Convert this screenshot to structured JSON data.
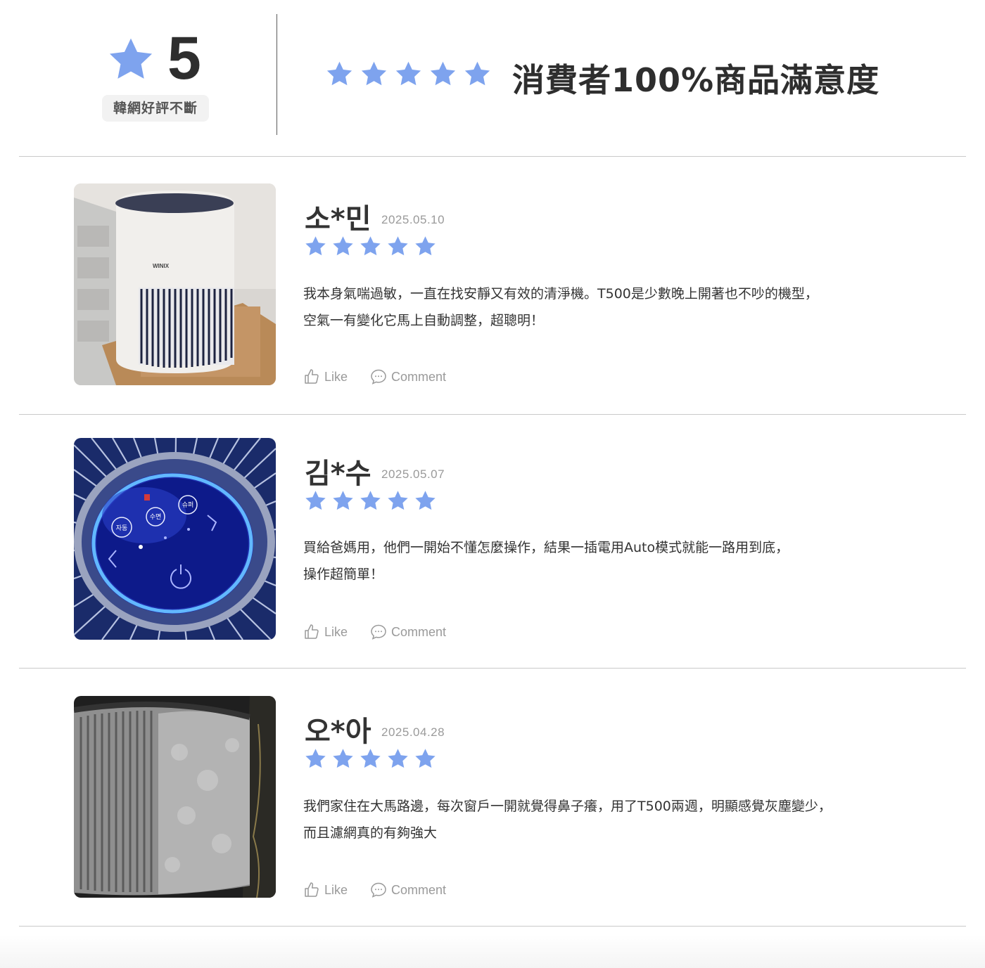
{
  "colors": {
    "star": "#7ea3ee",
    "text": "#2e2e2e",
    "muted": "#9a9a9a",
    "divider": "#c9c9c9"
  },
  "header": {
    "rating_value": "5",
    "rating_badge": "韓網好評不斷",
    "star_count": 5,
    "title": "消費者100%商品滿意度"
  },
  "reviews": [
    {
      "name": "소*민",
      "date": "2025.05.10",
      "stars": 5,
      "text_line1": "我本身氣喘過敏，一直在找安靜又有效的清淨機。T500是少數晚上開著也不吵的機型，",
      "text_line2": "空氣一有變化它馬上自動調整，超聰明！",
      "like_label": "Like",
      "comment_label": "Comment",
      "photo_icon": "air-purifier-photo",
      "photo_brand": "WINIX"
    },
    {
      "name": "김*수",
      "date": "2025.05.07",
      "stars": 5,
      "text_line1": "買給爸媽用，他們一開始不懂怎麼操作，結果一插電用Auto模式就能一路用到底，",
      "text_line2": "操作超簡單！",
      "like_label": "Like",
      "comment_label": "Comment",
      "photo_icon": "control-panel-photo",
      "photo_labels": [
        "자동",
        "수면",
        "슈퍼"
      ]
    },
    {
      "name": "오*아",
      "date": "2025.04.28",
      "stars": 5,
      "text_line1": "我們家住在大馬路邊，每次窗戶一開就覺得鼻子癢，用了T500兩週，明顯感覺灰塵變少，",
      "text_line2": "而且濾網真的有夠強大",
      "like_label": "Like",
      "comment_label": "Comment",
      "photo_icon": "dusty-filter-photo"
    }
  ]
}
